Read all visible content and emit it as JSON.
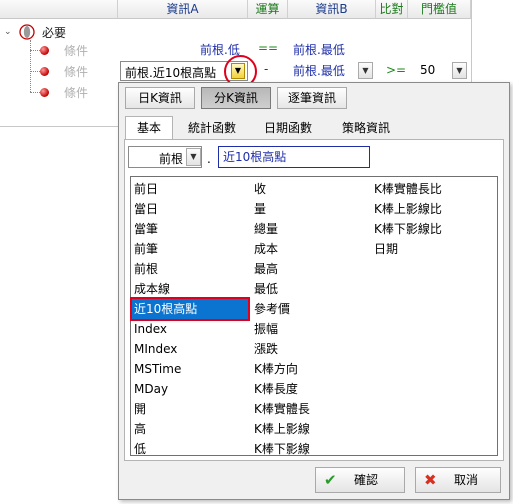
{
  "grid": {
    "headers": [
      "資訊A",
      "運算",
      "資訊B",
      "比對",
      "門檻值"
    ],
    "root_label": "必要",
    "condition_label": "條件",
    "row1": {
      "info_a": "前根.低",
      "op": "==",
      "info_b": "前根.最低"
    },
    "row2": {
      "info_a": "前根.近10根高點",
      "op": "-",
      "info_b": "前根.最低",
      "compare": ">=",
      "threshold": "50"
    }
  },
  "dialog": {
    "top_buttons": [
      "日K資訊",
      "分K資訊",
      "逐筆資訊"
    ],
    "active_top": "分K資訊",
    "tabs": [
      "基本",
      "統計函數",
      "日期函數",
      "策略資訊"
    ],
    "active_tab": "基本",
    "bar_select": "前根",
    "field_value": "近10根高點",
    "list_col1": [
      "前日",
      "當日",
      "當筆",
      "前筆",
      "前根",
      "成本線",
      "近10根高點",
      "Index",
      "MIndex",
      "MSTime",
      "MDay",
      "開",
      "高",
      "低"
    ],
    "list_col2": [
      "收",
      "量",
      "總量",
      "成本",
      "最高",
      "最低",
      "參考價",
      "振幅",
      "漲跌",
      "K棒方向",
      "K棒長度",
      "K棒實體長",
      "K棒上影線",
      "K棒下影線"
    ],
    "list_col3": [
      "K棒實體長比",
      "K棒上影線比",
      "K棒下影線比",
      "日期"
    ],
    "selected_item": "近10根高點",
    "ok_label": "確認",
    "cancel_label": "取消"
  },
  "colors": {
    "selection": "#0a74d0",
    "highlight_ring": "#e0001b",
    "link_blue": "#1e2ea8",
    "op_green": "#1a8a1a"
  }
}
